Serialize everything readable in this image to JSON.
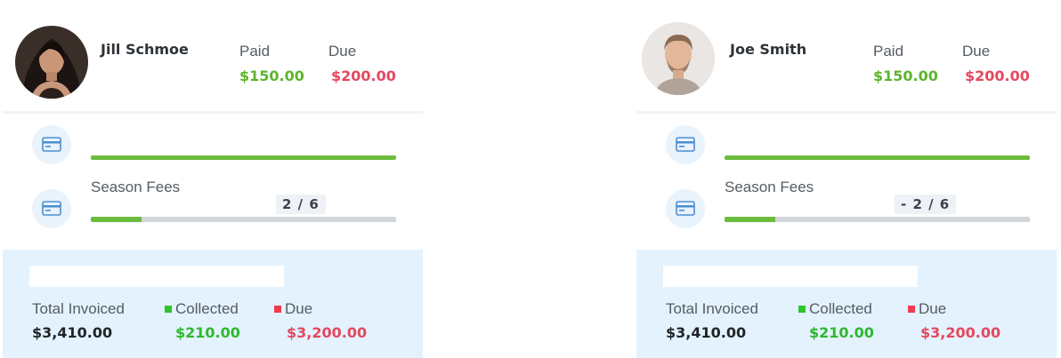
{
  "cards": [
    {
      "name": "Jill Schmoe",
      "paid_label": "Paid",
      "paid_value": "$150.00",
      "due_label": "Due",
      "due_value": "$200.00",
      "fee_title": "Season Fees",
      "fee_count": "2 / 6",
      "fee_progress": 0.1667,
      "first_bar_progress": 1.0,
      "summary": {
        "total_label": "Total Invoiced",
        "total_value": "$3,410.00",
        "collected_label": "Collected",
        "collected_value": "$210.00",
        "due_label": "Due",
        "due_value": "$3,200.00"
      }
    },
    {
      "name": "Joe Smith",
      "paid_label": "Paid",
      "paid_value": "$150.00",
      "due_label": "Due",
      "due_value": "$200.00",
      "fee_title": "Season Fees",
      "fee_count": "- 2 / 6",
      "fee_progress": 0.1667,
      "first_bar_progress": 1.0,
      "summary": {
        "total_label": "Total Invoiced",
        "total_value": "$3,410.00",
        "collected_label": "Collected",
        "collected_value": "$210.00",
        "due_label": "Due",
        "due_value": "$3,200.00"
      }
    }
  ],
  "colors": {
    "paid": "#5cb52c",
    "due": "#e5485f",
    "collected": "#2eb82e",
    "progress": "#6cbc3e",
    "summary_bg": "#e3f2fd"
  },
  "icons": {
    "avatar": "avatar",
    "fee_icon": "credit-card-icon"
  }
}
